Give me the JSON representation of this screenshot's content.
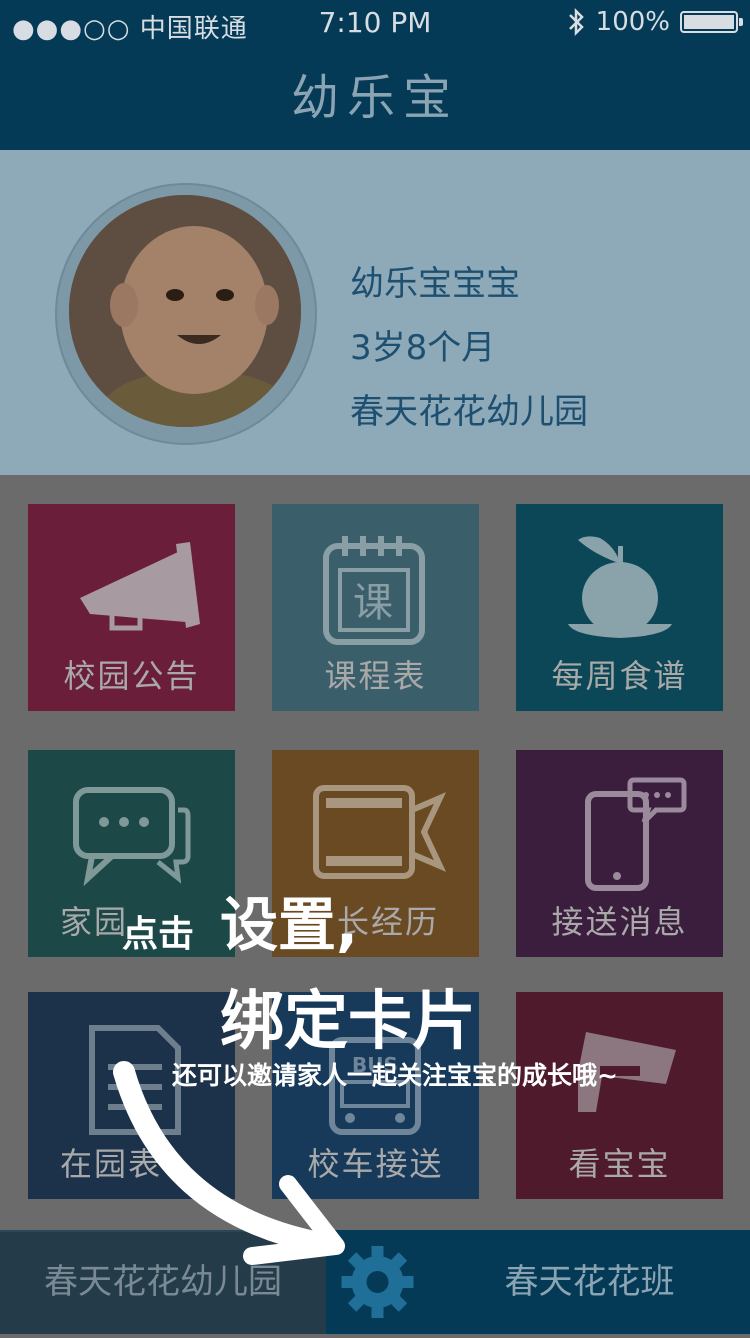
{
  "status_bar": {
    "carrier": "●●●○○ 中国联通",
    "time": "7:10 PM",
    "battery": "100%",
    "bluetooth_icon": "bluetooth-icon"
  },
  "nav": {
    "title": "幼乐宝"
  },
  "profile": {
    "name": "幼乐宝宝宝",
    "age": "3岁8个月",
    "school": "春天花花幼儿园"
  },
  "tiles": [
    {
      "label": "校园公告",
      "icon": "megaphone-icon",
      "color": "#6b1e3a"
    },
    {
      "label": "课程表",
      "icon": "calendar-icon",
      "icon_text": "课",
      "color": "#3b5f6a"
    },
    {
      "label": "每周食谱",
      "icon": "apple-icon",
      "color": "#0c4757"
    },
    {
      "label": "家园",
      "icon": "chat-icon",
      "color": "#1d4848"
    },
    {
      "label": "长经历",
      "icon": "film-icon",
      "color": "#6a4a22"
    },
    {
      "label": "接送消息",
      "icon": "phone-message-icon",
      "color": "#3b1e3e"
    },
    {
      "label": "在园表",
      "icon": "document-icon",
      "color": "#1c324a"
    },
    {
      "label": "校车接送",
      "icon": "bus-icon",
      "bus_text": "BUS",
      "color": "#173a5b"
    },
    {
      "label": "看宝宝",
      "icon": "camera-icon",
      "color": "#4e1a2c"
    }
  ],
  "bottom_bar": {
    "left": "春天花花幼儿园",
    "settings_icon": "gear-icon",
    "right": "春天花花班"
  },
  "overlay": {
    "line1_a": "点击",
    "line1_b": "设置,",
    "line2": "绑定卡片",
    "line3": "还可以邀请家人一起关注宝宝的成长哦~"
  }
}
